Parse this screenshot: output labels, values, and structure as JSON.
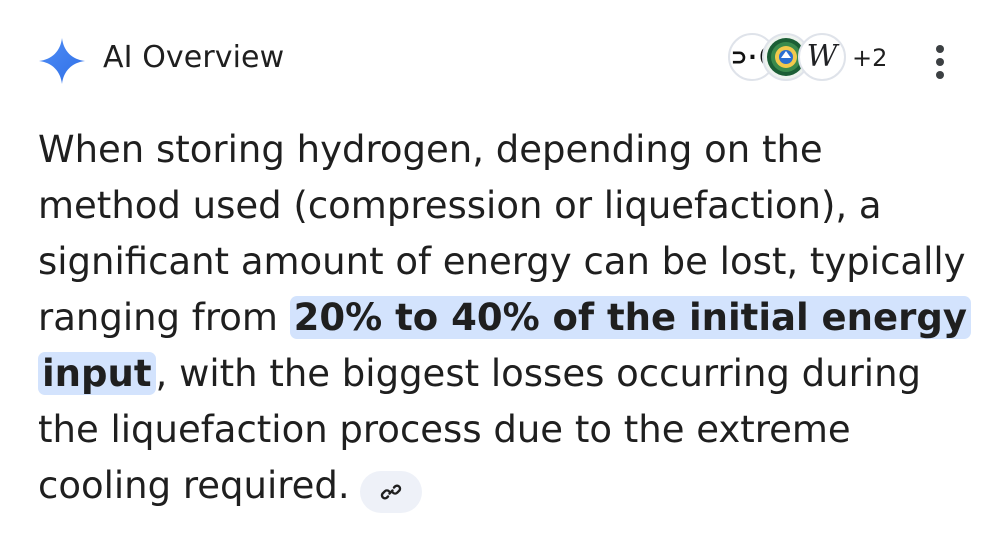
{
  "header": {
    "title": "AI Overview",
    "spark_icon": "gemini-spark-icon",
    "more_sources_count": "+2",
    "menu_icon": "more-vert-icon"
  },
  "sources": [
    {
      "name": "source-1",
      "glyph": "⊃·C"
    },
    {
      "name": "source-2",
      "icon": "energy-department-seal-icon"
    },
    {
      "name": "source-3",
      "glyph": "W"
    }
  ],
  "answer": {
    "text_before": "When storing hydrogen, depending on the method used (compression or liquefaction), a significant amount of energy can be lost, typically ranging from ",
    "highlight": "20% to 40% of the initial energy input",
    "text_after": ", with the biggest losses occurring during the liquefaction process due to the extreme cooling required.",
    "link_icon": "link-icon"
  },
  "colors": {
    "accent": "#4285f4",
    "highlight_bg": "#d3e3fd",
    "chip_bg": "#eef1f8",
    "text": "#1f1f1f"
  }
}
